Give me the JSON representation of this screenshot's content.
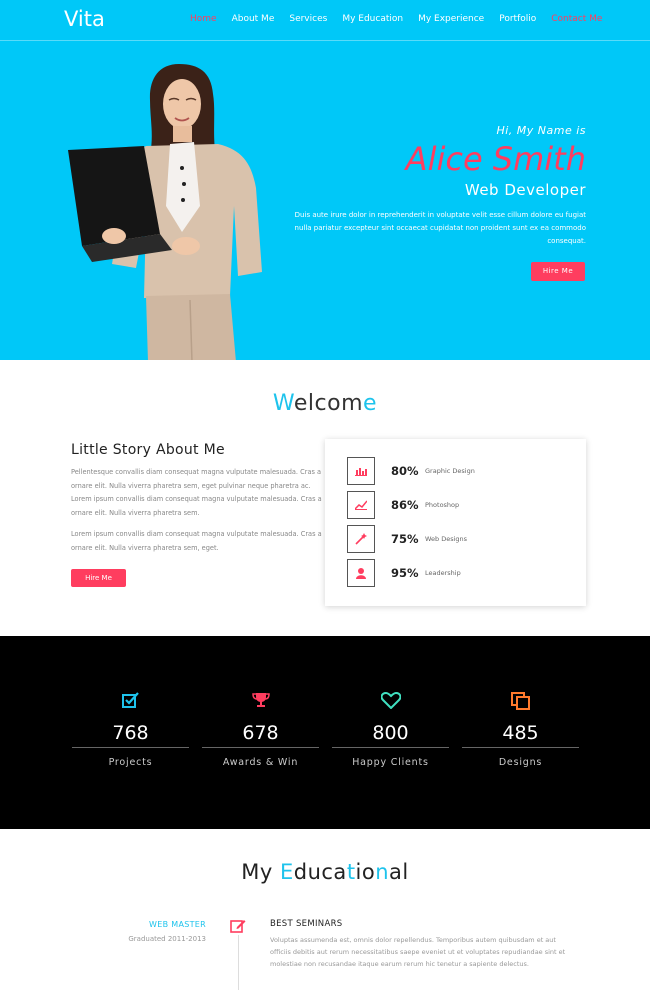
{
  "nav": {
    "brand": "Vita",
    "items": [
      "Home",
      "About Me",
      "Services",
      "My Education",
      "My Experience",
      "Portfolio",
      "Contact Me"
    ]
  },
  "hero": {
    "greeting": "Hi, My Name is",
    "name": "Alice Smith",
    "role": "Web Developer",
    "description": "Duis aute irure dolor in reprehenderit in voluptate velit esse cillum dolore eu fugiat nulla pariatur excepteur sint occaecat cupidatat non proident sunt ex ea commodo consequat.",
    "button": "Hire Me"
  },
  "welcome": {
    "title_parts": [
      "W",
      "elcom",
      "e"
    ],
    "story_title": "Little Story About Me",
    "paragraph1": "Pellentesque convallis diam consequat magna vulputate malesuada. Cras a ornare elit. Nulla viverra pharetra sem, eget pulvinar neque pharetra ac. Lorem ipsum convallis diam consequat magna vulputate malesuada. Cras a ornare elit. Nulla viverra pharetra sem.",
    "paragraph2": "Lorem ipsum convallis diam consequat magna vulputate malesuada. Cras a ornare elit. Nulla viverra pharetra sem, eget.",
    "button": "Hire Me",
    "skills": [
      {
        "pct": "80%",
        "label": "Graphic Design",
        "icon": "bar-chart-icon"
      },
      {
        "pct": "86%",
        "label": "Photoshop",
        "icon": "line-chart-icon"
      },
      {
        "pct": "75%",
        "label": "Web Designs",
        "icon": "magic-wand-icon"
      },
      {
        "pct": "95%",
        "label": "Leadership",
        "icon": "user-icon"
      }
    ]
  },
  "stats": [
    {
      "number": "768",
      "label": "Projects",
      "icon": "check-square-icon",
      "color": "#1ec3ec"
    },
    {
      "number": "678",
      "label": "Awards & Win",
      "icon": "trophy-icon",
      "color": "#ff3d5f"
    },
    {
      "number": "800",
      "label": "Happy Clients",
      "icon": "heart-icon",
      "color": "#40e0c0"
    },
    {
      "number": "485",
      "label": "Designs",
      "icon": "copy-icon",
      "color": "#ff7a2d"
    }
  ],
  "education": {
    "title_parts": [
      "My ",
      "E",
      "duca",
      "t",
      "io",
      "n",
      "al"
    ],
    "master": "WEB MASTER",
    "years": "Graduated 2011-2013",
    "heading": "BEST SEMINARS",
    "text": "Voluptas assumenda est, omnis dolor repellendus. Temporibus autem quibusdam et aut officiis debitis aut rerum necessitatibus saepe eveniet ut et voluptates repudiandae sint et molestiae non recusandae itaque earum rerum hic tenetur a sapiente delectus."
  },
  "colors": {
    "accent": "#00c8f8",
    "pink": "#ff3d5f",
    "cyan_text": "#1ec3ec"
  }
}
